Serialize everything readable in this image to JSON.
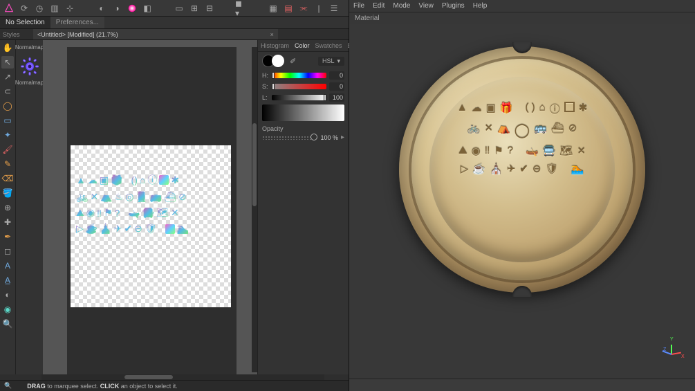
{
  "left_app": {
    "toolbar": {
      "logo_color": "#ff4dc2"
    },
    "context": {
      "no_selection": "No Selection",
      "preferences": "Preferences..."
    },
    "doc_tabs": {
      "styles_label": "Styles",
      "active": "<Untitled> [Modified] (21.7%)"
    },
    "left_panel": {
      "normalmap_tab": "Normalmap",
      "normalmap_label": "Normalmap"
    },
    "right_panel": {
      "tabs": [
        "Histogram",
        "Color",
        "Swatches",
        "Brushes"
      ],
      "active_tab": 1,
      "mode_label": "HSL",
      "h_label": "H:",
      "s_label": "S:",
      "l_label": "L:",
      "h_val": "0",
      "s_val": "0",
      "l_val": "100",
      "opacity_label": "Opacity",
      "opacity_val": "100 %"
    },
    "status": {
      "drag": "DRAG",
      "drag_rest": " to marquee select. ",
      "click": "CLICK",
      "click_rest": " an object to select it."
    }
  },
  "right_app": {
    "menu": [
      "File",
      "Edit",
      "Mode",
      "View",
      "Plugins",
      "Help"
    ],
    "panel_title": "Material",
    "axes": {
      "x": "X",
      "y": "Y",
      "z": "Z"
    }
  }
}
